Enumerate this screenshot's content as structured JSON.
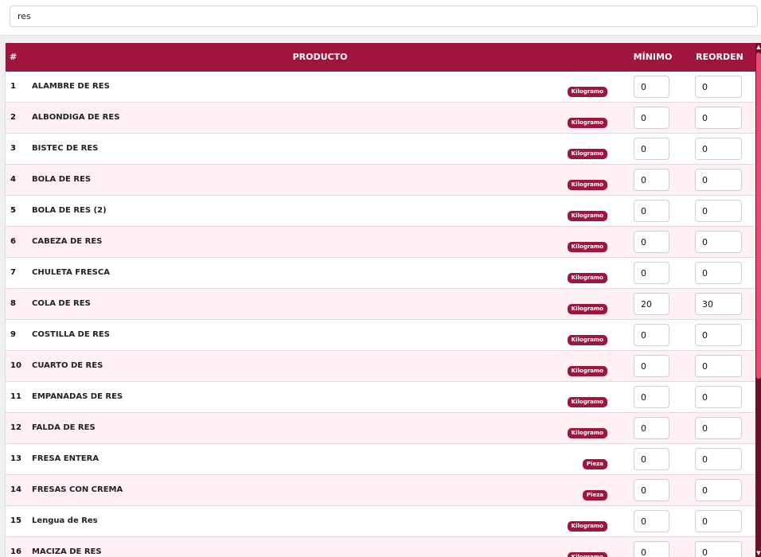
{
  "search": {
    "value": "res"
  },
  "table": {
    "headers": {
      "num": "#",
      "product": "PRODUCTO",
      "minimum": "MÍNIMO",
      "reorder": "REORDEN"
    },
    "rows": [
      {
        "num": "1",
        "name": "ALAMBRE DE RES",
        "unit": "Kilogramo",
        "min": "0",
        "reorder": "0"
      },
      {
        "num": "2",
        "name": "ALBONDIGA DE RES",
        "unit": "Kilogramo",
        "min": "0",
        "reorder": "0"
      },
      {
        "num": "3",
        "name": "BISTEC DE RES",
        "unit": "Kilogramo",
        "min": "0",
        "reorder": "0"
      },
      {
        "num": "4",
        "name": "BOLA DE RES",
        "unit": "Kilogramo",
        "min": "0",
        "reorder": "0"
      },
      {
        "num": "5",
        "name": "BOLA DE RES (2)",
        "unit": "Kilogramo",
        "min": "0",
        "reorder": "0"
      },
      {
        "num": "6",
        "name": "CABEZA DE RES",
        "unit": "Kilogramo",
        "min": "0",
        "reorder": "0"
      },
      {
        "num": "7",
        "name": "CHULETA FRESCA",
        "unit": "Kilogramo",
        "min": "0",
        "reorder": "0"
      },
      {
        "num": "8",
        "name": "COLA DE RES",
        "unit": "Kilogramo",
        "min": "20",
        "reorder": "30"
      },
      {
        "num": "9",
        "name": "COSTILLA DE RES",
        "unit": "Kilogramo",
        "min": "0",
        "reorder": "0"
      },
      {
        "num": "10",
        "name": "CUARTO DE RES",
        "unit": "Kilogramo",
        "min": "0",
        "reorder": "0"
      },
      {
        "num": "11",
        "name": "EMPANADAS DE RES",
        "unit": "Kilogramo",
        "min": "0",
        "reorder": "0"
      },
      {
        "num": "12",
        "name": "FALDA DE RES",
        "unit": "Kilogramo",
        "min": "0",
        "reorder": "0"
      },
      {
        "num": "13",
        "name": "FRESA ENTERA",
        "unit": "Pieza",
        "min": "0",
        "reorder": "0"
      },
      {
        "num": "14",
        "name": "FRESAS CON CREMA",
        "unit": "Pieza",
        "min": "0",
        "reorder": "0"
      },
      {
        "num": "15",
        "name": "Lengua de Res",
        "unit": "Kilogramo",
        "min": "0",
        "reorder": "0"
      },
      {
        "num": "16",
        "name": "MACIZA DE RES",
        "unit": "Kilogramo",
        "min": "0",
        "reorder": "0"
      }
    ]
  },
  "colors": {
    "accent": "#a0153e",
    "row_alt": "#fff0f3",
    "scroll_thumb": "#e94a6f"
  }
}
